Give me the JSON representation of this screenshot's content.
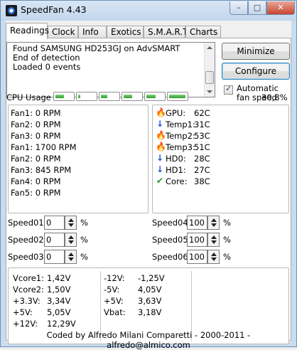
{
  "window": {
    "title": "SpeedFan 4.43",
    "minimize": "–",
    "maximize": "□",
    "close": "✕"
  },
  "tabs": [
    {
      "label": "Readings",
      "active": true
    },
    {
      "label": "Clock"
    },
    {
      "label": "Info"
    },
    {
      "label": "Exotics"
    },
    {
      "label": "S.M.A.R.T."
    },
    {
      "label": "Charts"
    }
  ],
  "log": {
    "lines": [
      "Found SAMSUNG HD253GJ on AdvSMART",
      "End of detection",
      "Loaded 0 events"
    ]
  },
  "buttons": {
    "minimize": "Minimize",
    "configure": "Configure"
  },
  "auto_fan": {
    "label": "Automatic fan speed",
    "checked": true,
    "mark": "✓"
  },
  "cpu": {
    "label": "CPU Usage",
    "cores": [
      0.45,
      0.1,
      0.35,
      0.45,
      0.5,
      0.9
    ],
    "percent": "30,8%"
  },
  "fans": [
    "Fan1: 0 RPM",
    "Fan2: 0 RPM",
    "Fan3: 0 RPM",
    "Fan1: 1700 RPM",
    "Fan2: 0 RPM",
    "Fan3: 845 RPM",
    "Fan4: 0 RPM",
    "Fan5: 0 RPM"
  ],
  "temps": [
    {
      "name": "GPU:",
      "value": "62C",
      "icon": "flame-icon",
      "glyph": "🔥"
    },
    {
      "name": "Temp1:",
      "value": "31C",
      "icon": "down-arrow-icon",
      "glyph": "↓"
    },
    {
      "name": "Temp2:",
      "value": "53C",
      "icon": "flame-icon",
      "glyph": "🔥"
    },
    {
      "name": "Temp3:",
      "value": "51C",
      "icon": "flame-icon",
      "glyph": "🔥"
    },
    {
      "name": "HD0:",
      "value": "28C",
      "icon": "down-arrow-icon",
      "glyph": "↓"
    },
    {
      "name": "HD1:",
      "value": "27C",
      "icon": "down-arrow-icon",
      "glyph": "↓"
    },
    {
      "name": "Core:",
      "value": "38C",
      "icon": "check-icon",
      "glyph": "✔"
    }
  ],
  "speeds_left": [
    {
      "label": "Speed01:",
      "value": "0",
      "unit": "%"
    },
    {
      "label": "Speed02:",
      "value": "0",
      "unit": "%"
    },
    {
      "label": "Speed03:",
      "value": "0",
      "unit": "%"
    }
  ],
  "speeds_right": [
    {
      "label": "Speed04:",
      "value": "100",
      "unit": "%"
    },
    {
      "label": "Speed05:",
      "value": "100",
      "unit": "%"
    },
    {
      "label": "Speed06:",
      "value": "100",
      "unit": "%"
    }
  ],
  "voltages_left": [
    {
      "name": "Vcore1:",
      "value": "1,42V"
    },
    {
      "name": "Vcore2:",
      "value": "1,50V"
    },
    {
      "name": "+3.3V:",
      "value": "3,34V"
    },
    {
      "name": "+5V:",
      "value": "5,05V"
    },
    {
      "name": "+12V:",
      "value": "12,29V"
    }
  ],
  "voltages_right": [
    {
      "name": "-12V:",
      "value": "-1,25V"
    },
    {
      "name": "-5V:",
      "value": "4,05V"
    },
    {
      "name": "+5V:",
      "value": "3,63V"
    },
    {
      "name": "Vbat:",
      "value": "3,18V"
    }
  ],
  "footer": "Coded by Alfredo Milani Comparetti - 2000-2011 - alfredo@almico.com"
}
